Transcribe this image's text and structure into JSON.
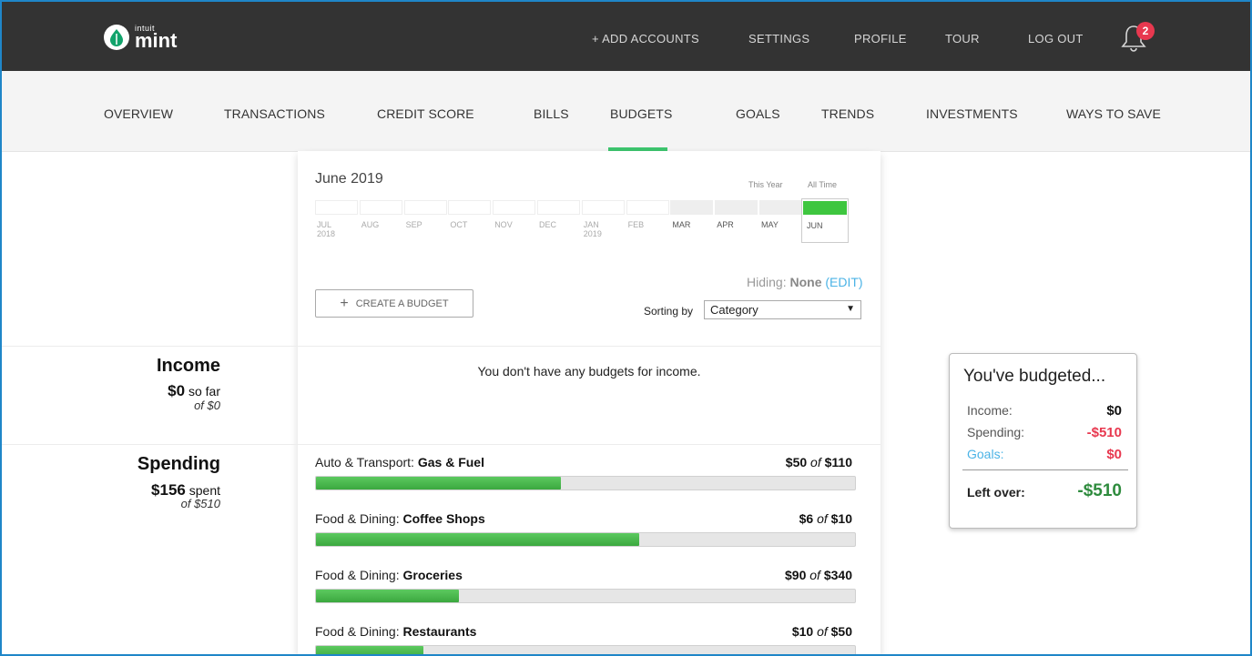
{
  "app": {
    "logo_small": "intuit",
    "logo_big": "mint"
  },
  "top_links": [
    "+ ADD ACCOUNTS",
    "SETTINGS",
    "PROFILE",
    "TOUR",
    "LOG OUT"
  ],
  "notification_count": "2",
  "nav": [
    "OVERVIEW",
    "TRANSACTIONS",
    "CREDIT SCORE",
    "BILLS",
    "BUDGETS",
    "GOALS",
    "TRENDS",
    "INVESTMENTS",
    "WAYS TO SAVE"
  ],
  "nav_active": "BUDGETS",
  "timeline": {
    "title": "June 2019",
    "this_year": "This Year",
    "all_time": "All Time",
    "months": [
      {
        "label": "JUL",
        "year": "2018"
      },
      {
        "label": "AUG",
        "year": ""
      },
      {
        "label": "SEP",
        "year": ""
      },
      {
        "label": "OCT",
        "year": ""
      },
      {
        "label": "NOV",
        "year": ""
      },
      {
        "label": "DEC",
        "year": ""
      },
      {
        "label": "JAN",
        "year": "2019"
      },
      {
        "label": "FEB",
        "year": ""
      },
      {
        "label": "MAR",
        "year": ""
      },
      {
        "label": "APR",
        "year": ""
      },
      {
        "label": "MAY",
        "year": ""
      },
      {
        "label": "JUN",
        "year": ""
      }
    ]
  },
  "hiding": {
    "label": "Hiding:",
    "value": "None",
    "edit": "(EDIT)"
  },
  "create_budget_label": "CREATE A BUDGET",
  "sorting": {
    "label": "Sorting by",
    "selected": "Category"
  },
  "income": {
    "title": "Income",
    "amount": "$0",
    "suffix": "so far",
    "of": "of $0",
    "empty_message": "You don't have any budgets for income."
  },
  "spending": {
    "title": "Spending",
    "amount": "$156",
    "suffix": "spent",
    "of": "of $510"
  },
  "budgets": [
    {
      "category": "Auto & Transport:",
      "sub": "Gas & Fuel",
      "spent": "$50",
      "of": "of",
      "total": "$110",
      "progress": 0.4545
    },
    {
      "category": "Food & Dining:",
      "sub": "Coffee Shops",
      "spent": "$6",
      "of": "of",
      "total": "$10",
      "progress": 0.6
    },
    {
      "category": "Food & Dining:",
      "sub": "Groceries",
      "spent": "$90",
      "of": "of",
      "total": "$340",
      "progress": 0.2647
    },
    {
      "category": "Food & Dining:",
      "sub": "Restaurants",
      "spent": "$10",
      "of": "of",
      "total": "$50",
      "progress": 0.2
    }
  ],
  "summary": {
    "title": "You've budgeted...",
    "income_label": "Income:",
    "income_value": "$0",
    "spending_label": "Spending:",
    "spending_value": "-$510",
    "goals_label": "Goals:",
    "goals_value": "$0",
    "leftover_label": "Left over:",
    "leftover_value": "-$510"
  },
  "colors": {
    "accent_green": "#3ec66f",
    "negative_red": "#e8384f",
    "link_blue": "#4bb3e6",
    "leftover_green": "#2e8b3d"
  }
}
